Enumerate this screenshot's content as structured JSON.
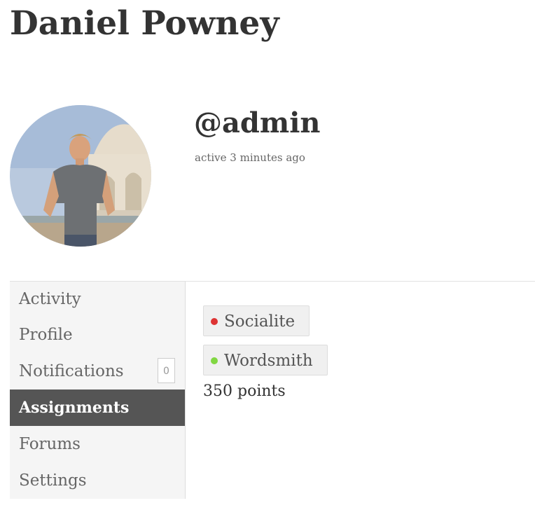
{
  "profile": {
    "display_name": "Daniel Powney",
    "username": "@admin",
    "activity": "active 3 minutes ago"
  },
  "nav": {
    "items": [
      {
        "label": "Activity"
      },
      {
        "label": "Profile"
      },
      {
        "label": "Notifications",
        "count": "0"
      },
      {
        "label": "Assignments",
        "current": true
      },
      {
        "label": "Forums"
      },
      {
        "label": "Settings"
      }
    ]
  },
  "assignments": {
    "badges": [
      {
        "label": "Socialite",
        "color": "#dd3333"
      },
      {
        "label": "Wordsmith",
        "color": "#81d742"
      }
    ],
    "points": "350 points"
  },
  "colors": {
    "text": "#333333",
    "nav_current_bg": "#555555",
    "nav_bg": "#f5f5f5"
  }
}
